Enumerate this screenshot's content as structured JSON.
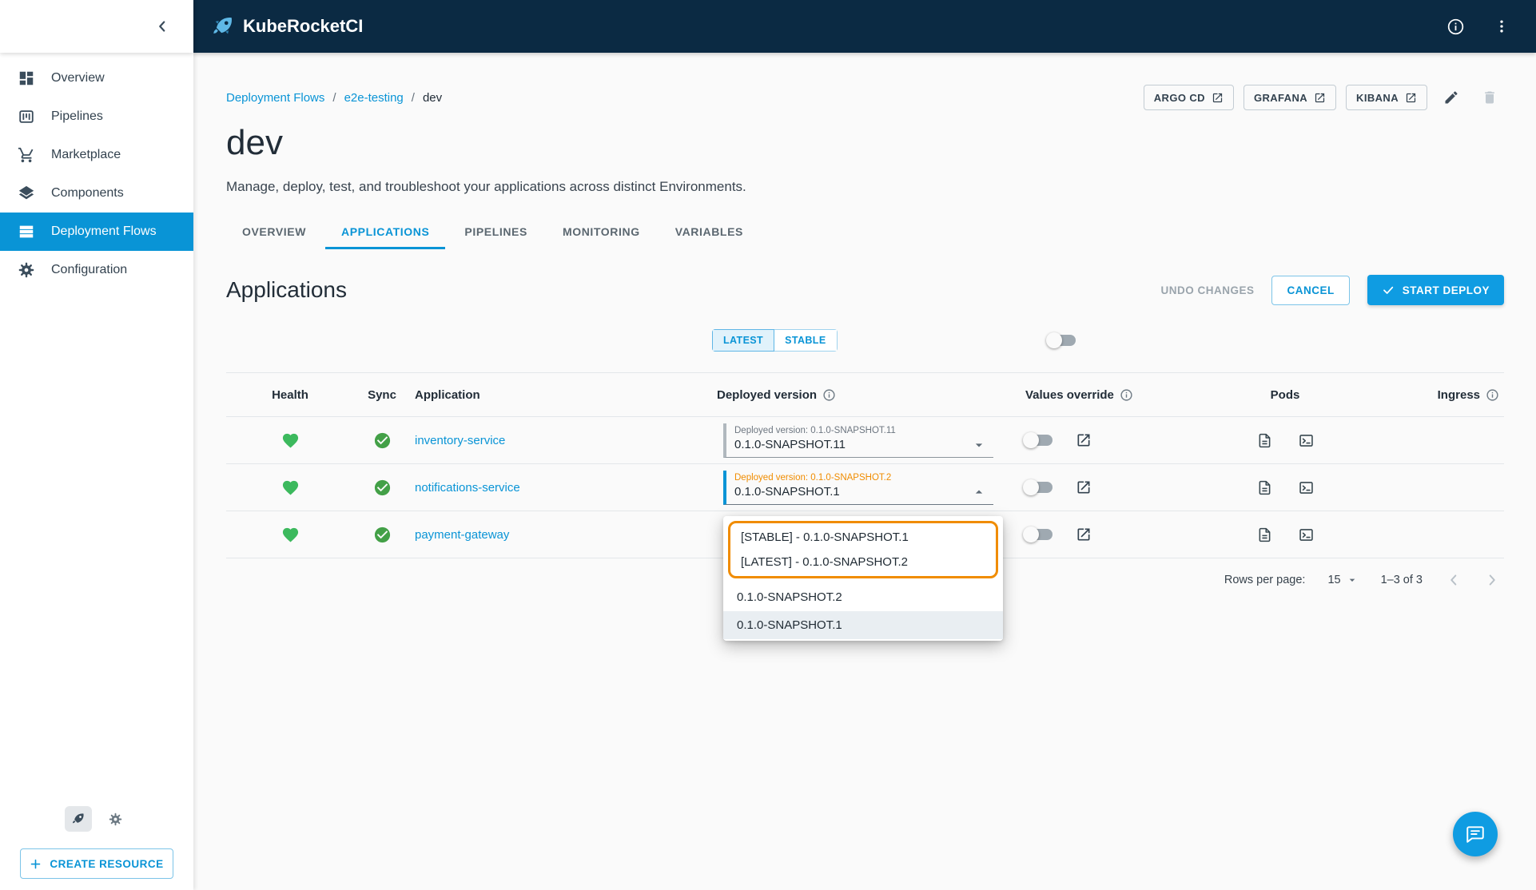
{
  "colors": {
    "accent": "#0994d6",
    "topbar_bg": "#0b2a43",
    "highlight_orange": "#f08c00",
    "health_green": "#3cb95d",
    "sync_green": "#43a047"
  },
  "topbar": {
    "brand": "KubeRocketCI"
  },
  "sidebar": {
    "items": [
      {
        "label": "Overview"
      },
      {
        "label": "Pipelines"
      },
      {
        "label": "Marketplace"
      },
      {
        "label": "Components"
      },
      {
        "label": "Deployment Flows"
      },
      {
        "label": "Configuration"
      }
    ],
    "create_button": "CREATE RESOURCE"
  },
  "breadcrumb": {
    "separator": "/",
    "items": [
      "Deployment Flows",
      "e2e-testing",
      "dev"
    ]
  },
  "header": {
    "title": "dev",
    "subtitle": "Manage, deploy, test, and troubleshoot your applications across distinct Environments.",
    "quick_links": [
      "ARGO CD",
      "GRAFANA",
      "KIBANA"
    ]
  },
  "tabs": [
    "OVERVIEW",
    "APPLICATIONS",
    "PIPELINES",
    "MONITORING",
    "VARIABLES"
  ],
  "applications": {
    "heading": "Applications",
    "undo_label": "UNDO CHANGES",
    "cancel_label": "CANCEL",
    "deploy_label": "START DEPLOY",
    "version_toggle": [
      "LATEST",
      "STABLE"
    ],
    "columns": [
      "Health",
      "Sync",
      "Application",
      "Deployed version",
      "Values override",
      "Pods",
      "Ingress"
    ],
    "rows": [
      {
        "app": "inventory-service",
        "version_label": "Deployed version: 0.1.0-SNAPSHOT.11",
        "version_value": "0.1.0-SNAPSHOT.11"
      },
      {
        "app": "notifications-service",
        "version_label": "Deployed version: 0.1.0-SNAPSHOT.2",
        "version_value": "0.1.0-SNAPSHOT.1"
      },
      {
        "app": "payment-gateway",
        "version_label": "",
        "version_value": ""
      }
    ],
    "pagination": {
      "rows_per_page_label": "Rows per page:",
      "rows_per_page": "15",
      "range": "1–3 of 3"
    }
  },
  "version_dropdown": {
    "pinned": [
      "[STABLE] - 0.1.0-SNAPSHOT.1",
      "[LATEST] - 0.1.0-SNAPSHOT.2"
    ],
    "options": [
      "0.1.0-SNAPSHOT.2",
      "0.1.0-SNAPSHOT.1"
    ]
  }
}
